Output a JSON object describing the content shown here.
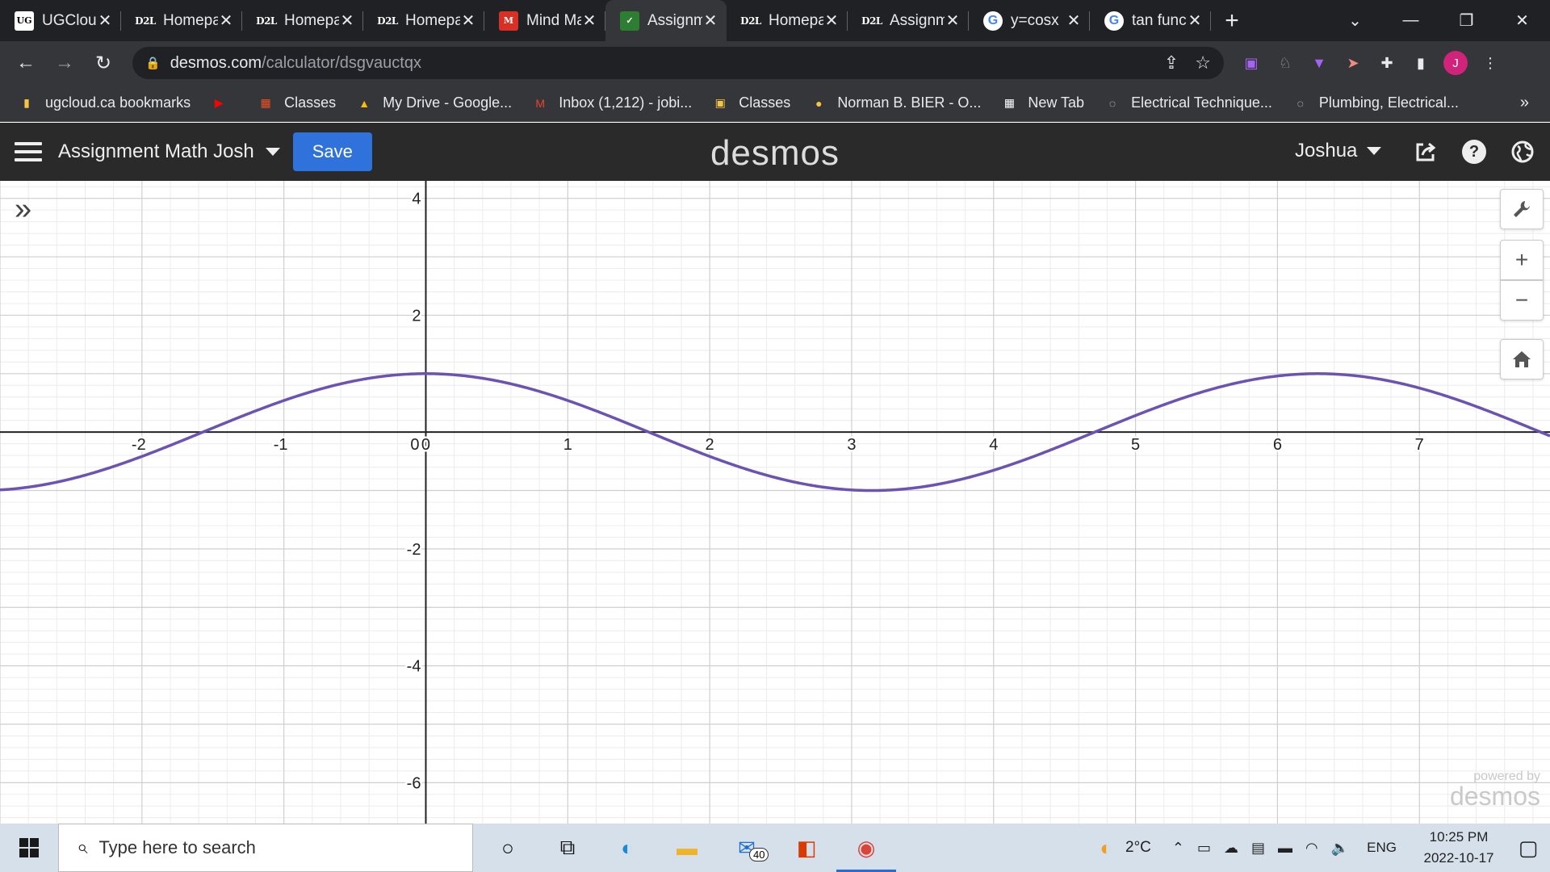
{
  "browser": {
    "tabs": [
      {
        "title": "UGCloud",
        "favicon": "ugcloud-icon",
        "fav_text": "UG",
        "close": "✕"
      },
      {
        "title": "Homepage",
        "favicon": "d2l-icon",
        "fav_text": "D2L",
        "close": "✕"
      },
      {
        "title": "Homepage",
        "favicon": "d2l-icon",
        "fav_text": "D2L",
        "close": "✕"
      },
      {
        "title": "Homepage",
        "favicon": "d2l-icon",
        "fav_text": "D2L",
        "close": "✕"
      },
      {
        "title": "Mind Map",
        "favicon": "mind-icon",
        "fav_text": "M",
        "close": "✕"
      },
      {
        "title": "Assignment",
        "favicon": "desmos-icon",
        "fav_text": "✓",
        "close": "✕",
        "active": true
      },
      {
        "title": "Homepage",
        "favicon": "d2l-icon",
        "fav_text": "D2L",
        "close": "✕"
      },
      {
        "title": "Assignment",
        "favicon": "d2l-icon",
        "fav_text": "D2L",
        "close": "✕"
      },
      {
        "title": "y=cosx",
        "favicon": "google-icon",
        "fav_text": "G",
        "close": "✕"
      },
      {
        "title": "tan function",
        "favicon": "google-icon",
        "fav_text": "G",
        "close": "✕"
      }
    ],
    "new_tab": "+",
    "window": {
      "minimize": "—",
      "restore": "❐",
      "close": "✕",
      "tab_search": "⌄"
    },
    "nav": {
      "back": "←",
      "forward": "→",
      "reload": "↻"
    },
    "url_host": "desmos.com",
    "url_path": "/calculator/dsgvauctqx",
    "omni_icons": {
      "share": "⇪",
      "star": "☆"
    },
    "extensions": {
      "ext1": "▣",
      "ext2": "♘",
      "ext3": "▼",
      "ext4": "➤",
      "puzzle": "✚",
      "sidepanel": "▮",
      "menu": "⋮"
    },
    "profile_initial": "J",
    "bookmarks": [
      {
        "label": "ugcloud.ca bookmarks",
        "icon": "folder-icon",
        "glyph": "▮",
        "color": "#f4c542"
      },
      {
        "label": "",
        "icon": "youtube-icon",
        "glyph": "▶",
        "color": "#ff0000"
      },
      {
        "label": "Classes",
        "icon": "microsoft-icon",
        "glyph": "▦",
        "color": "#f25022"
      },
      {
        "label": "My Drive - Google...",
        "icon": "drive-icon",
        "glyph": "▲",
        "color": "#fbbc04"
      },
      {
        "label": "Inbox (1,212) - jobi...",
        "icon": "gmail-icon",
        "glyph": "M",
        "color": "#ea4335"
      },
      {
        "label": "Classes",
        "icon": "classroom-icon",
        "glyph": "▣",
        "color": "#f4c542"
      },
      {
        "label": "Norman B. BIER - O...",
        "icon": "school-icon",
        "glyph": "●",
        "color": "#f4c542"
      },
      {
        "label": "New Tab",
        "icon": "ugcloud-icon",
        "glyph": "▦",
        "color": "#ffffff"
      },
      {
        "label": "Electrical Technique...",
        "icon": "loading-icon",
        "glyph": "◌",
        "color": "#e8eaed"
      },
      {
        "label": "Plumbing, Electrical...",
        "icon": "loading-icon",
        "glyph": "◌",
        "color": "#e8eaed"
      }
    ],
    "bookmarks_more": "»"
  },
  "desmos": {
    "graph_title": "Assignment Math Josh",
    "save_label": "Save",
    "logo": "desmos",
    "user_name": "Joshua",
    "header_icons": {
      "share": "⇪",
      "help": "?",
      "globe": "◍"
    },
    "expand": "»",
    "tools": {
      "wrench": "🔧",
      "zoom_in": "+",
      "zoom_out": "−",
      "home": "⌂"
    },
    "powered_line1": "powered by",
    "powered_line2": "desmos",
    "curve_color": "#6b52b3"
  },
  "chart_data": {
    "type": "line",
    "title": "",
    "xlabel": "",
    "ylabel": "",
    "xlim": [
      -3.0,
      7.92
    ],
    "ylim": [
      -6.7,
      4.3
    ],
    "x_ticks": [
      -2,
      -1,
      0,
      1,
      2,
      3,
      4,
      5,
      6,
      7
    ],
    "y_ticks": [
      -6,
      -4,
      -2,
      2,
      4
    ],
    "grid": true,
    "minor_grid_step": 0.2,
    "series": [
      {
        "function": "cos(x)",
        "color": "#6b52b3"
      }
    ]
  },
  "taskbar": {
    "search_placeholder": "Type here to search",
    "search_icon": "⌕",
    "apps": [
      {
        "name": "cortana-icon",
        "glyph": "○",
        "color": "#111111"
      },
      {
        "name": "task-view-icon",
        "glyph": "⧉",
        "color": "#111111"
      },
      {
        "name": "edge-icon",
        "glyph": "◐",
        "color": "#1a8ad4"
      },
      {
        "name": "file-explorer-icon",
        "glyph": "▬",
        "color": "#f0b429"
      },
      {
        "name": "mail-icon",
        "glyph": "✉",
        "color": "#1a6fd0"
      },
      {
        "name": "office-icon",
        "glyph": "◧",
        "color": "#d83b01"
      },
      {
        "name": "chrome-icon",
        "glyph": "◉",
        "color": "#db4437",
        "active": true
      }
    ],
    "mail_badge": "40",
    "weather_temp": "2°C",
    "tray_icons": {
      "chevron": "⌃",
      "meet": "▭",
      "cloud": "☁",
      "monitor": "▤",
      "battery": "▬",
      "wifi": "◠",
      "volume": "🔈"
    },
    "language": "ENG",
    "time": "10:25 PM",
    "date": "2022-10-17",
    "notifications": "▢"
  }
}
